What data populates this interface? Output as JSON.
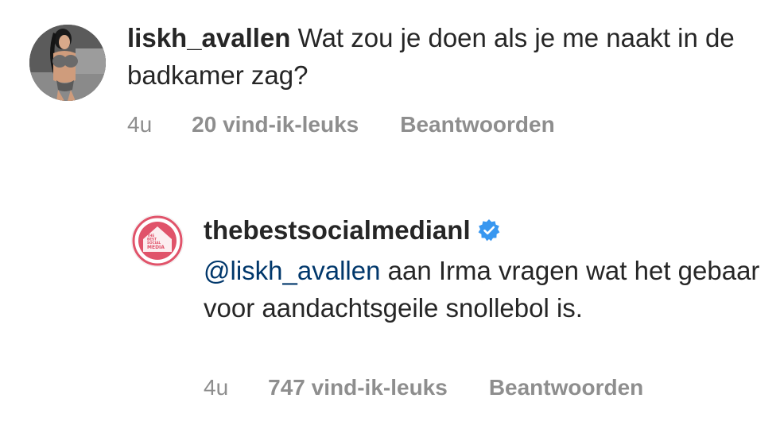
{
  "comments": [
    {
      "username": "liskh_avallen",
      "text": "Wat zou je doen als je me naakt in de badkamer zag?",
      "time": "4u",
      "likes": "20 vind-ik-leuks",
      "reply_label": "Beantwoorden",
      "verified": false
    },
    {
      "username": "thebestsocialmedianl",
      "mention": "@liskh_avallen",
      "text": "aan Irma vragen wat het gebaar voor aandachtsgeile snollebol is.",
      "time": "4u",
      "likes": "747 vind-ik-leuks",
      "reply_label": "Beantwoorden",
      "verified": true,
      "avatar_logo": {
        "line1": "THE",
        "line2": "BEST",
        "line3": "SOCIAL",
        "line4": "MEDIA"
      }
    }
  ],
  "colors": {
    "text": "#262626",
    "meta": "#8e8e8e",
    "mention": "#00376b",
    "verified_badge": "#3897f0",
    "logo_accent": "#e0536a"
  }
}
